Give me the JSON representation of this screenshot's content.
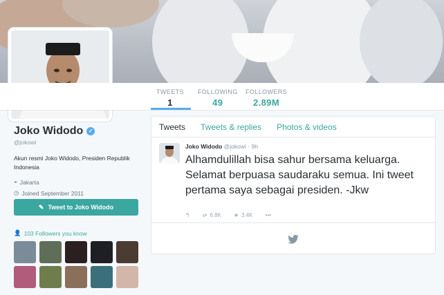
{
  "stats": [
    {
      "label": "TWEETS",
      "value": "1"
    },
    {
      "label": "FOLLOWING",
      "value": "49"
    },
    {
      "label": "FOLLOWERS",
      "value": "2.89M"
    }
  ],
  "profile": {
    "name": "Joko Widodo",
    "handle": "@jokowi",
    "bio": "Akun resmi Joko Widodo, Presiden Republik Indonesia",
    "location": "Jakarta",
    "joined": "Joined September 2011",
    "tweet_button": "Tweet to Joko Widodo",
    "followers_you_know": "103 Followers you know"
  },
  "timeline": {
    "tabs": [
      "Tweets",
      "Tweets & replies",
      "Photos & videos"
    ],
    "tweet": {
      "author": "Joko Widodo",
      "handle": "@jokowi",
      "time": "· 9h",
      "text": "Alhamdulillah bisa sahur bersama keluarga. Selamat berpuasa saudaraku semua. Ini tweet pertama saya sebagai presiden. -Jkw",
      "retweets": "6.8K",
      "favorites": "3.4K"
    }
  },
  "colors": {
    "accent": "#3aa7a0",
    "link": "#55acee"
  },
  "icons": [
    "verified-icon",
    "location-icon",
    "clock-icon",
    "compose-icon",
    "followers-icon",
    "reply-icon",
    "retweet-icon",
    "favorite-icon",
    "more-icon",
    "bird-icon"
  ]
}
